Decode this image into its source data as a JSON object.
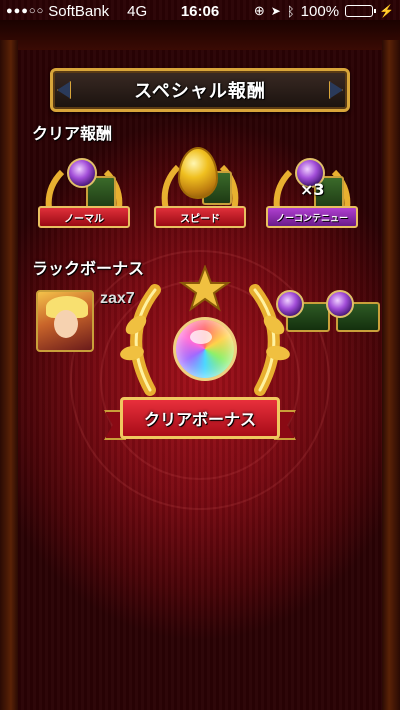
{
  "status_bar": {
    "signal": "●●●○○",
    "carrier": "SoftBank",
    "network": "4G",
    "time": "16:06",
    "battery": "100%"
  },
  "title": "スペシャル報酬",
  "clear_reward": {
    "label": "クリア報酬",
    "badges": [
      {
        "label": "ノーマル",
        "reward": "orb",
        "ribbon_color": "#c8141e"
      },
      {
        "label": "スピード",
        "reward": "golden-egg",
        "ribbon_color": "#c8141e"
      },
      {
        "label": "ノーコンテニュー",
        "reward": "orb",
        "multiplier": "×3",
        "ribbon_color": "#8a2aa8"
      }
    ]
  },
  "luck_bonus": {
    "label": "ラックボーナス",
    "player_name": "zax7"
  },
  "clear_bonus": {
    "label": "クリアボーナス",
    "reward": "rainbow-orb"
  },
  "colors": {
    "background": "#7a0a12",
    "gold": "#d8a53a",
    "ribbon_red": "#c8141e",
    "ribbon_purple": "#8a2aa8"
  }
}
